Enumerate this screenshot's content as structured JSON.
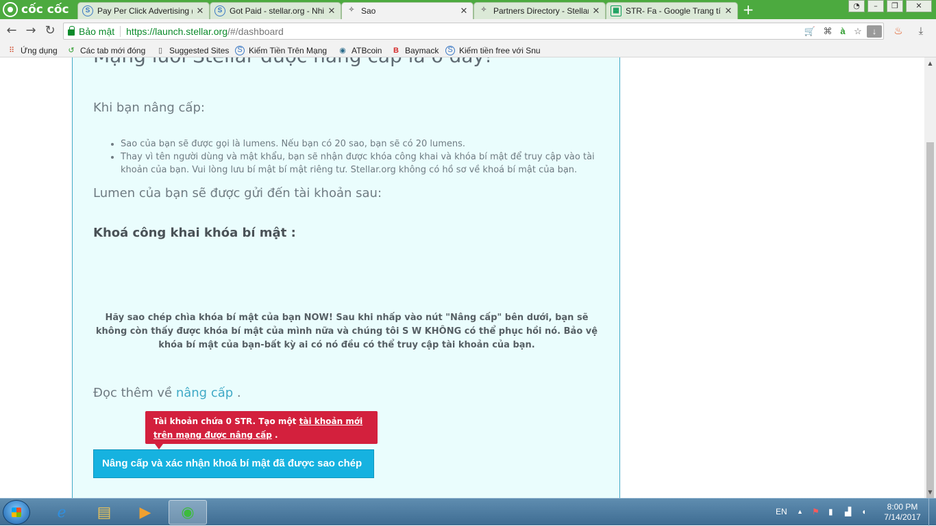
{
  "browser": {
    "logo_text": "cốc cốc",
    "tabs": [
      {
        "title": "Pay Per Click Advertising (",
        "icon": "stellar-icon"
      },
      {
        "title": "Got Paid - stellar.org - Nhi",
        "icon": "stellar-icon"
      },
      {
        "title": "Sao",
        "icon": "rocket-icon"
      },
      {
        "title": "Partners Directory - Stellar",
        "icon": "rocket-icon"
      },
      {
        "title": "STR- Fa - Google Trang tín",
        "icon": "sheets-icon"
      }
    ],
    "active_tab_index": 2,
    "secure_label": "Bảo mật",
    "url_host": "https://launch.stellar.org",
    "url_path": "/#/dashboard",
    "bookmarks": [
      {
        "label": "Ứng dụng",
        "icon": "apps-grid-icon"
      },
      {
        "label": "Các tab mới đóng",
        "icon": "history-icon"
      },
      {
        "label": "Suggested Sites",
        "icon": "page-icon"
      },
      {
        "label": "Kiếm Tiền Trên Mạng",
        "icon": "stellar-icon"
      },
      {
        "label": "ATBcoin",
        "icon": "atb-icon"
      },
      {
        "label": "Baymack",
        "icon": "b-logo-icon"
      },
      {
        "label": "Kiếm tiền free với Snu",
        "icon": "stellar-icon"
      }
    ]
  },
  "page": {
    "heading": "Mạng lưới Stellar được nâng cấp là ở đây!",
    "when_upgrade": "Khi bạn nâng cấp:",
    "bullets": [
      "Sao của bạn sẽ được gọi là lumens. Nếu bạn có 20 sao, bạn sẽ có 20 lumens.",
      "Thay vì tên người dùng và mật khẩu, bạn sẽ nhận được khóa công khai và khóa bí mật để truy cập vào tài khoản của bạn. Vui lòng lưu bí mật bí mật riêng tư. Stellar.org không có hồ sơ về khoá bí mật của bạn."
    ],
    "send_to": "Lumen của bạn sẽ được gửi đến tài khoản sau:",
    "key_label": "Khoá công khai khóa bí mật :",
    "warning": "Hãy sao chép chìa khóa bí mật của bạn NOW! Sau khi nhấp vào nút \"Nâng cấp\" bên dưới, bạn sẽ không còn thấy được khóa bí mật của mình nữa và chúng tôi S W KHÔNG có thể phục hồi nó. Bảo vệ khóa bí mật của bạn-bất kỳ ai có nó đều có thể truy cập tài khoản của bạn.",
    "read_more_prefix": "Đọc thêm về ",
    "read_more_link": "nâng cấp",
    "read_more_suffix": " .",
    "tooltip_prefix": "Tài khoản chứa 0 STR. Tạo một ",
    "tooltip_link": "tài khoản mới trên mạng được nâng cấp",
    "tooltip_suffix": " .",
    "upgrade_button": "Nâng cấp và xác nhận khoá bí mật đã được sao chép"
  },
  "taskbar": {
    "language": "EN",
    "time": "8:00 PM",
    "date": "7/14/2017"
  },
  "colors": {
    "browser_green": "#4caa3f",
    "panel_bg": "#eafdfd",
    "panel_border": "#3fa9c6",
    "tooltip_red": "#d3203d",
    "button_blue": "#16b2e0"
  }
}
